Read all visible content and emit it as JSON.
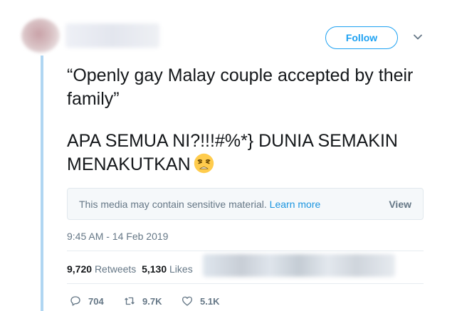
{
  "header": {
    "follow_label": "Follow"
  },
  "tweet": {
    "line1": "“Openly gay Malay couple accepted by their family”",
    "line2": "APA SEMUA NI?!!!#%*} DUNIA SEMAKIN MENAKUTKAN",
    "emoji": "weary-face"
  },
  "media_warning": {
    "message": "This media may contain sensitive material.",
    "learn_more": "Learn more",
    "view_label": "View"
  },
  "timestamp": "9:45 AM - 14 Feb 2019",
  "stats": {
    "retweets_count": "9,720",
    "retweets_label": "Retweets",
    "likes_count": "5,130",
    "likes_label": "Likes"
  },
  "actions": {
    "replies": "704",
    "retweets": "9.7K",
    "likes": "5.1K"
  },
  "colors": {
    "accent": "#1da1f2",
    "muted": "#657786",
    "thread": "#b0d6f2"
  }
}
